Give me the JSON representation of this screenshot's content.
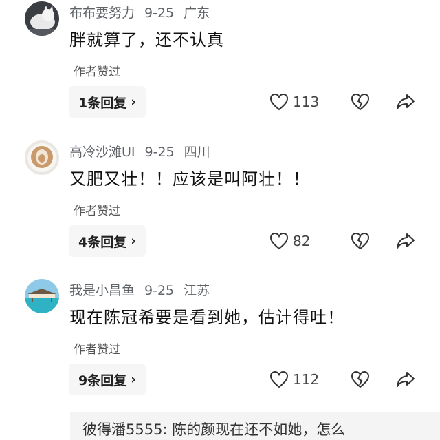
{
  "comments": [
    {
      "username": "布布要努力",
      "date": "9-25",
      "location": "广东",
      "text": "胖就算了，还不认真",
      "author_liked": "作者赞过",
      "replies_label": "1条回复",
      "likes": "113",
      "avatar_icon": "white-cat-avatar"
    },
    {
      "username": "高冷沙滩UI",
      "date": "9-25",
      "location": "四川",
      "text": "又肥又壮！！应该是叫阿壮！！",
      "author_liked": "作者赞过",
      "replies_label": "4条回复",
      "likes": "82",
      "avatar_icon": "latte-art-avatar"
    },
    {
      "username": "我是小昌鱼",
      "date": "9-25",
      "location": "江苏",
      "text": "现在陈冠希要是看到她，估计得吐！",
      "author_liked": "作者赞过",
      "replies_label": "9条回复",
      "likes": "112",
      "avatar_icon": "beach-villa-avatar"
    }
  ],
  "reply_preview": {
    "text": "彼得潘5555: 陈的颜现在还不如她，怎么"
  },
  "colors": {
    "meta": "#5f6368",
    "reply_bg": "#f6f6f6",
    "icon": "#333333"
  }
}
